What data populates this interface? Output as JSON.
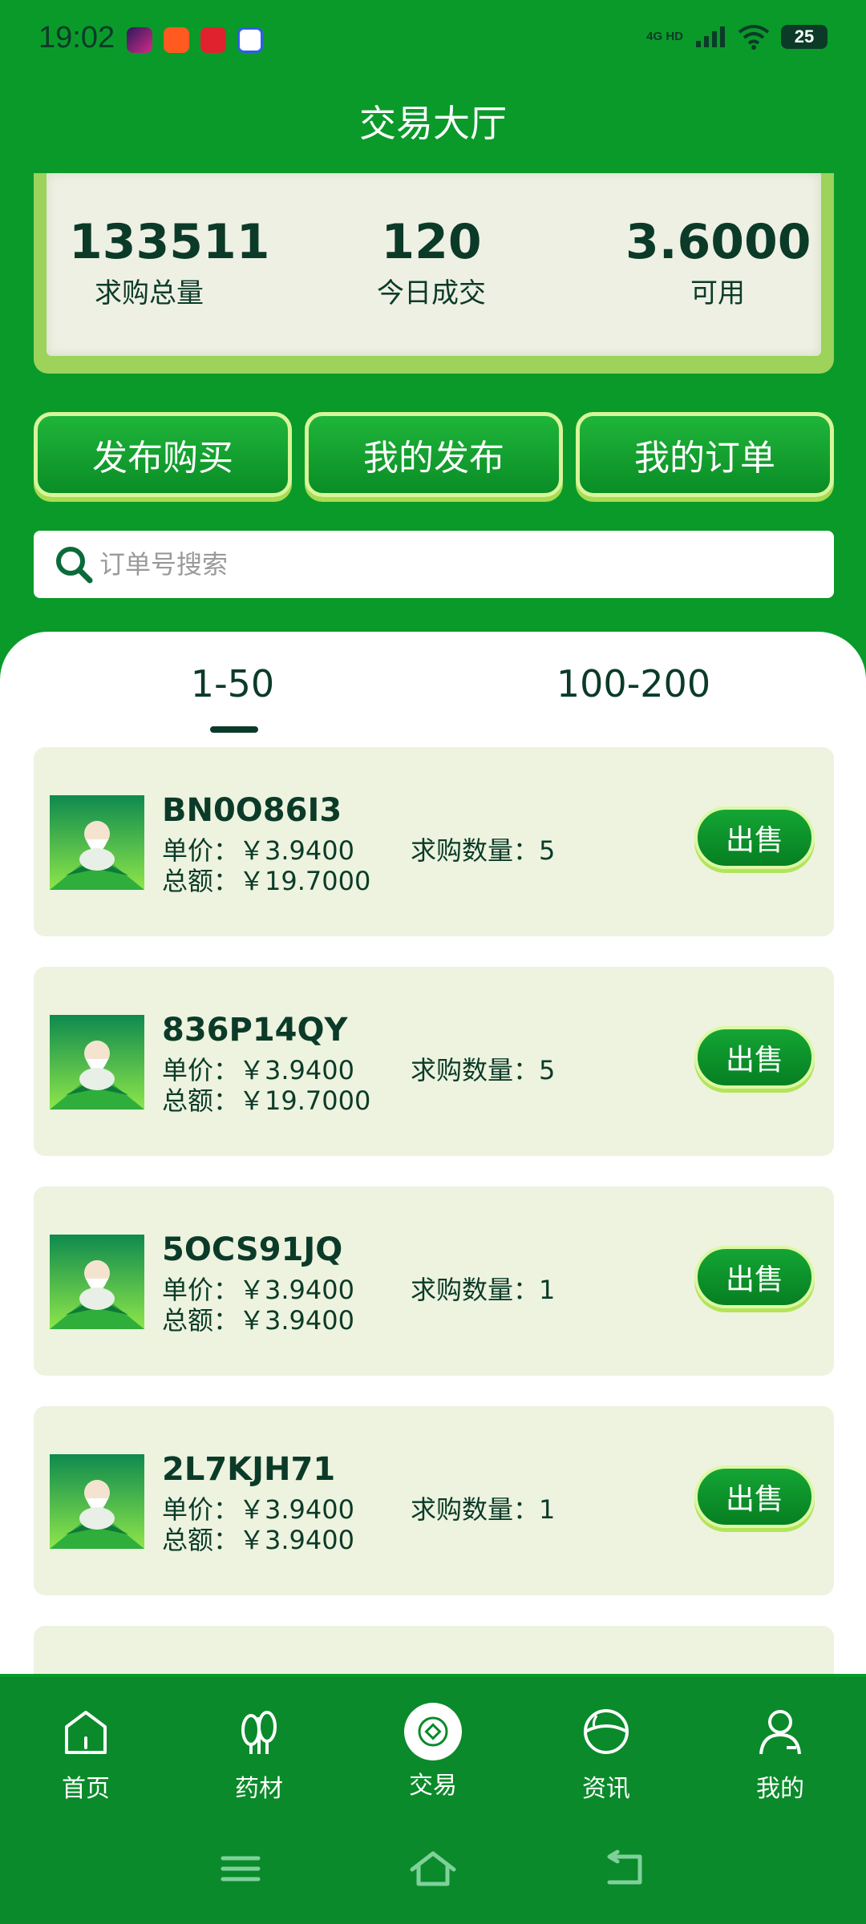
{
  "status_bar": {
    "time": "19:02",
    "network": "4G HD",
    "battery": "25",
    "app_icons": [
      "video-app-icon",
      "orange-app-icon",
      "tmall-app-icon",
      "baidu-app-icon"
    ]
  },
  "page": {
    "title": "交易大厅"
  },
  "stats": [
    {
      "value": "133511",
      "label": "求购总量"
    },
    {
      "value": "120",
      "label": "今日成交"
    },
    {
      "value": "3.6000",
      "label": "可用"
    }
  ],
  "actions": {
    "publish_buy": "发布购买",
    "my_publish": "我的发布",
    "my_orders": "我的订单"
  },
  "search": {
    "placeholder": "订单号搜索"
  },
  "tabs": [
    {
      "label": "1-50",
      "active": true
    },
    {
      "label": "100-200",
      "active": false
    }
  ],
  "orders": [
    {
      "id": "BN0O86I3",
      "price": "单价：￥3.9400",
      "total": "总额：￥19.7000",
      "qty": "求购数量：5",
      "action": "出售"
    },
    {
      "id": "836P14QY",
      "price": "单价：￥3.9400",
      "total": "总额：￥19.7000",
      "qty": "求购数量：5",
      "action": "出售"
    },
    {
      "id": "5OCS91JQ",
      "price": "单价：￥3.9400",
      "total": "总额：￥3.9400",
      "qty": "求购数量：1",
      "action": "出售"
    },
    {
      "id": "2L7KJH71",
      "price": "单价：￥3.9400",
      "total": "总额：￥3.9400",
      "qty": "求购数量：1",
      "action": "出售"
    }
  ],
  "bottom_nav": [
    {
      "label": "首页",
      "icon": "home-icon"
    },
    {
      "label": "药材",
      "icon": "herb-tree-icon"
    },
    {
      "label": "交易",
      "icon": "trade-icon",
      "active": true
    },
    {
      "label": "资讯",
      "icon": "news-globe-icon"
    },
    {
      "label": "我的",
      "icon": "profile-icon"
    }
  ],
  "colors": {
    "primary_green": "#0a9a2a",
    "dark_text": "#0b3b28",
    "card_bg": "#edf3df",
    "accent_lime": "#d8f59a"
  }
}
